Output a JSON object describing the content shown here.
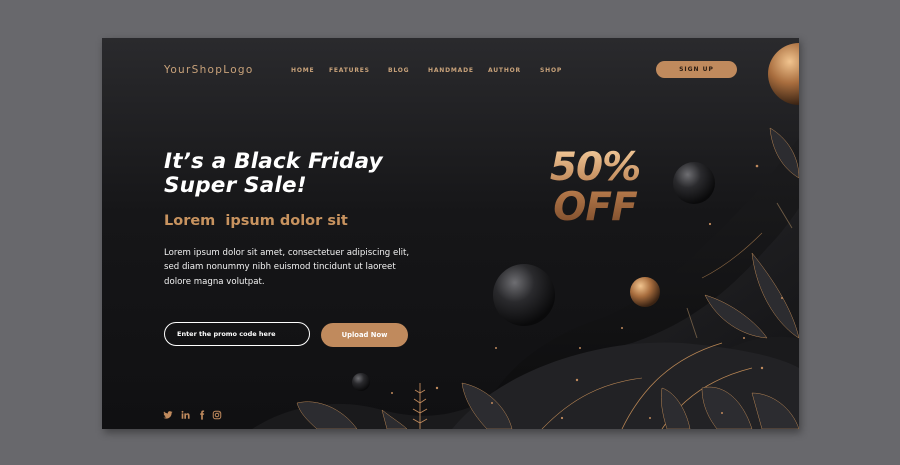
{
  "brand": {
    "logo_text": "YourShopLogo"
  },
  "nav": {
    "items": [
      {
        "label": "HOME"
      },
      {
        "label": "FEATURES"
      },
      {
        "label": "BLOG"
      },
      {
        "label": "HANDMADE"
      },
      {
        "label": "AUTHOR"
      },
      {
        "label": "SHOP"
      }
    ],
    "signup_label": "SIGN UP"
  },
  "hero": {
    "title_line1": "It’s a Black Friday",
    "title_line2": "Super Sale!",
    "subtitle": "Lorem  ipsum dolor sit",
    "body_line1": "Lorem ipsum dolor sit amet, consectetuer adipiscing elit,",
    "body_line2": "sed diam nonummy nibh euismod tincidunt ut laoreet",
    "body_line3": "dolore magna volutpat."
  },
  "promo": {
    "placeholder": "Enter the promo code here",
    "value": "",
    "button_label": "Upload Now"
  },
  "deal": {
    "line1": "50%",
    "line2": "OFF"
  },
  "social": {
    "icons": [
      "twitter-icon",
      "linkedin-icon",
      "facebook-icon",
      "instagram-icon"
    ]
  },
  "colors": {
    "accent": "#c08a5d",
    "background": "#141416",
    "page": "#68686c"
  }
}
